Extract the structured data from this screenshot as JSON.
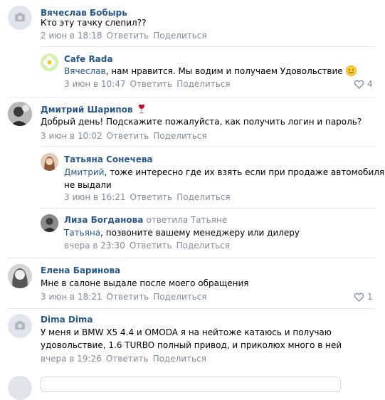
{
  "comments": [
    {
      "author": "Вячеслав Бобырь",
      "text": "Кто эту тачку слепил??",
      "date": "2 июн в 18:18",
      "reply": "Ответить",
      "share": "Поделиться"
    },
    {
      "author": "Cafe Rada",
      "mention": "Вячеслав",
      "text": ", нам нравится. Мы водим и получаем Удовольствие",
      "date": "3 июн в 10:47",
      "reply": "Ответить",
      "share": "Поделиться",
      "likes": "4"
    },
    {
      "author": "Дмитрий Шарипов",
      "text": "Добрый день! Подскажите пожалуйста, как получить логин и пароль?",
      "date": "3 июн в 10:02",
      "reply": "Ответить",
      "share": "Поделиться"
    },
    {
      "author": "Татьяна Сонечева",
      "mention": "Дмитрий",
      "text_line1": ", тоже интересно где их взять если при продаже автомобиля",
      "text_line2": "не выдали",
      "date": "3 июн в 16:21",
      "reply": "Ответить",
      "share": "Поделиться"
    },
    {
      "author": "Лиза Богданова",
      "reply_to": "ответила Татьяне",
      "mention": "Татьяна",
      "text": ", позвоните вашему менеджеру или дилеру",
      "date": "вчера в 23:30",
      "reply": "Ответить",
      "share": "Поделиться"
    },
    {
      "author": "Елена Баринова",
      "text": "Мне в салоне выдале после моего обращения",
      "date": "3 июн в 18:21",
      "reply": "Ответить",
      "share": "Поделиться",
      "likes": "1"
    },
    {
      "author": "Dima Dima",
      "text_line1": "У меня и BMW X5 4.4 и OMODA я на нейтоже катаюсь и получаю",
      "text_line2": "удовольствие, 1.6 TURBO полный привод, и приколюх много в ней",
      "date": "вчера в 19:26",
      "reply": "Ответить",
      "share": "Поделиться"
    }
  ]
}
